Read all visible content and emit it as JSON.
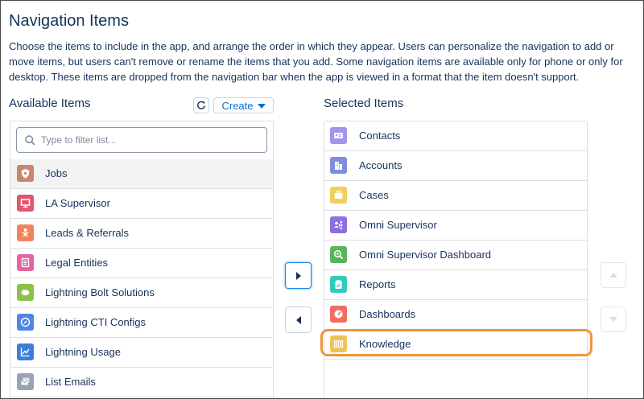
{
  "header": {
    "title": "Navigation Items",
    "description": "Choose the items to include in the app, and arrange the order in which they appear. Users can personalize the navigation to add or move items, but users can't remove or rename the items that you add. Some navigation items are available only for phone or only for desktop. These items are dropped from the navigation bar when the app is viewed in a format that the item doesn't support."
  },
  "available": {
    "title": "Available Items",
    "create_label": "Create",
    "search_placeholder": "Type to filter list...",
    "items": [
      {
        "label": "Jobs",
        "icon": "shield-icon",
        "color": "#c8866b"
      },
      {
        "label": "LA Supervisor",
        "icon": "monitor-icon",
        "color": "#e3566d"
      },
      {
        "label": "Leads & Referrals",
        "icon": "person-star-icon",
        "color": "#f1845d"
      },
      {
        "label": "Legal Entities",
        "icon": "document-icon",
        "color": "#e563a1"
      },
      {
        "label": "Lightning Bolt Solutions",
        "icon": "cloud-icon",
        "color": "#8cc14b"
      },
      {
        "label": "Lightning CTI Configs",
        "icon": "compass-icon",
        "color": "#4f86e7"
      },
      {
        "label": "Lightning Usage",
        "icon": "line-chart-icon",
        "color": "#3b7fd8"
      },
      {
        "label": "List Emails",
        "icon": "emails-icon",
        "color": "#98a3b3"
      }
    ]
  },
  "selected": {
    "title": "Selected Items",
    "items": [
      {
        "label": "Contacts",
        "icon": "contact-card-icon",
        "color": "#a094ed"
      },
      {
        "label": "Accounts",
        "icon": "building-icon",
        "color": "#7f8de1"
      },
      {
        "label": "Cases",
        "icon": "briefcase-icon",
        "color": "#f2cf5b"
      },
      {
        "label": "Omni Supervisor",
        "icon": "people-network-icon",
        "color": "#8d6ee3"
      },
      {
        "label": "Omni Supervisor Dashboard",
        "icon": "magnify-plus-icon",
        "color": "#56b55b"
      },
      {
        "label": "Reports",
        "icon": "report-icon",
        "color": "#2ecbbe"
      },
      {
        "label": "Dashboards",
        "icon": "gauge-icon",
        "color": "#ef6e64"
      },
      {
        "label": "Knowledge",
        "icon": "book-icon",
        "color": "#ecc55a"
      }
    ]
  },
  "colors": {
    "accent": "#0070d2",
    "highlight": "#f0953a",
    "text": "#16325c"
  }
}
